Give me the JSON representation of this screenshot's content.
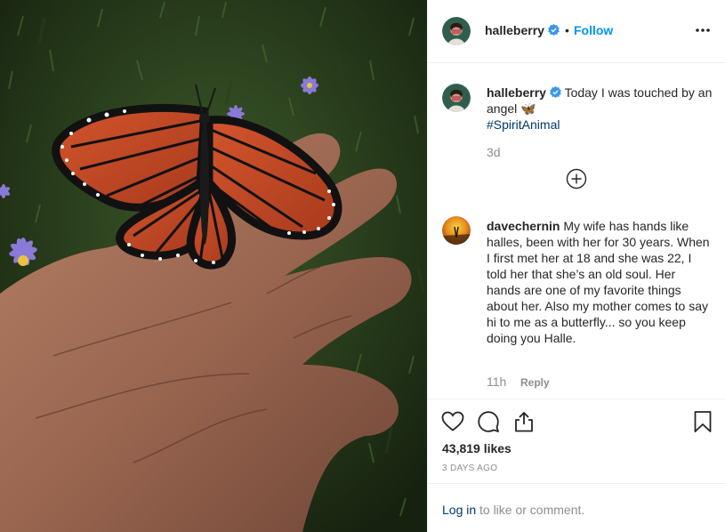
{
  "post": {
    "author": "halleberry",
    "follow_label": "Follow",
    "separator": "•"
  },
  "caption": {
    "username": "halleberry",
    "text": "Today I was touched by an angel",
    "emoji": "🦋",
    "hashtag": "#SpiritAnimal",
    "time": "3d"
  },
  "comment": {
    "username": "davechernin",
    "text": "My wife has hands like halles, been with her for 30 years. When I first met her at 18 and she was 22, I told her that she’s an old soul. Her hands are one of my favorite things about her. Also my mother comes to say hi to me as a butterfly... so you keep doing you Halle.",
    "time": "11h",
    "reply_label": "Reply"
  },
  "stats": {
    "likes": "43,819 likes",
    "date": "3 DAYS AGO"
  },
  "footer": {
    "login_link": "Log in",
    "login_text": "to like or comment."
  },
  "icons": {
    "verified": "verified-badge-icon",
    "more": "more-options-icon",
    "load_more": "plus-circle-icon",
    "like": "heart-icon",
    "comment": "comment-icon",
    "share": "share-icon",
    "save": "bookmark-icon"
  },
  "colors": {
    "link_blue": "#0095f6",
    "hashtag": "#00376b",
    "muted": "#8e8e8e",
    "verified": "#3897f0"
  }
}
